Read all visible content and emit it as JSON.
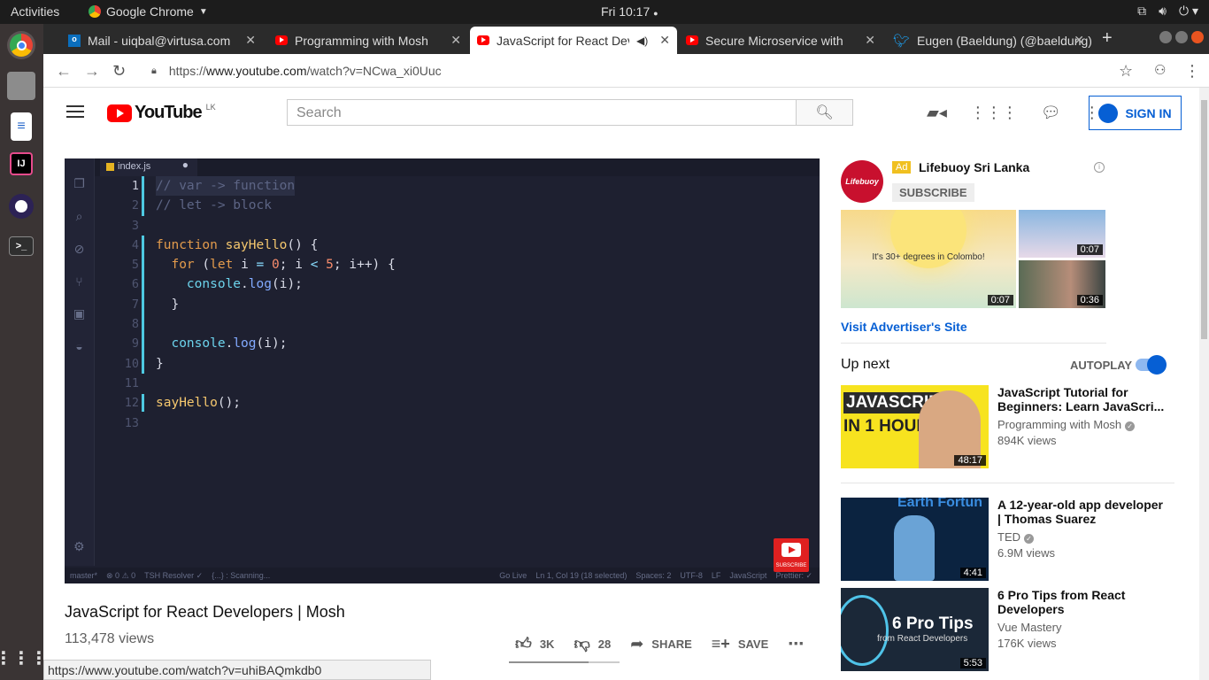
{
  "os": {
    "activities": "Activities",
    "app_name": "Google Chrome",
    "clock": "Fri 10:17"
  },
  "tabs": [
    {
      "title": "Mail - uiqbal@virtusa.com"
    },
    {
      "title": "Programming with Mosh"
    },
    {
      "title": "JavaScript for React Developers"
    },
    {
      "title": "Secure Microservice with"
    },
    {
      "title": "Eugen (Baeldung) (@baeldung)"
    }
  ],
  "address": {
    "prefix": "https://",
    "domain": "www.youtube.com",
    "path": "/watch?v=NCwa_xi0Uuc"
  },
  "yt": {
    "region": "LK",
    "logo_text": "YouTube",
    "search_placeholder": "Search",
    "signin": "SIGN IN"
  },
  "player": {
    "filename": "index.js",
    "code": [
      {
        "n": "1",
        "html": "// var -> function"
      },
      {
        "n": "2",
        "html": "// let -> block"
      },
      {
        "n": "3",
        "html": ""
      },
      {
        "n": "4",
        "html": "function sayHello() {"
      },
      {
        "n": "5",
        "html": "  for (let i = 0; i < 5; i++) {"
      },
      {
        "n": "6",
        "html": "    console.log(i);"
      },
      {
        "n": "7",
        "html": "  }"
      },
      {
        "n": "8",
        "html": ""
      },
      {
        "n": "9",
        "html": "  console.log(i);"
      },
      {
        "n": "10",
        "html": "}"
      },
      {
        "n": "11",
        "html": ""
      },
      {
        "n": "12",
        "html": "sayHello();"
      },
      {
        "n": "13",
        "html": ""
      }
    ],
    "status_left": [
      "master*",
      "⊗ 0 ⚠ 0",
      "TSH Resolver ✓",
      "{...} : Scanning..."
    ],
    "status_right": [
      "Go Live",
      "Ln 1, Col 19 (18 selected)",
      "Spaces: 2",
      "UTF-8",
      "LF",
      "JavaScript",
      "Prettier: ✓"
    ],
    "subscribe_wm": "SUBSCRIBE"
  },
  "video": {
    "title": "JavaScript for React Developers | Mosh",
    "views": "113,478 views",
    "likes": "3K",
    "dislikes": "28",
    "share": "SHARE",
    "save": "SAVE",
    "like_ratio": 0.72
  },
  "ad": {
    "badge": "Ad",
    "name": "Lifebuoy Sri Lanka",
    "subscribe": "SUBSCRIBE",
    "logo_text": "Lifebuoy",
    "main_caption": "It's 30+ degrees in Colombo!",
    "main_duration": "0:07",
    "thumb1_duration": "0:07",
    "thumb2_duration": "0:36",
    "visit": "Visit Advertiser's Site"
  },
  "upnext": {
    "label": "Up next",
    "autoplay": "AUTOPLAY",
    "autoplay_on": true
  },
  "recs": [
    {
      "title": "JavaScript Tutorial for Beginners: Learn JavaScri...",
      "channel": "Programming with Mosh",
      "views": "894K views",
      "duration": "48:17",
      "thumb_line1": "JAVASCRIPT",
      "thumb_line2": "IN 1 HOUR"
    },
    {
      "title": "A 12-year-old app developer | Thomas Suarez",
      "channel": "TED",
      "views": "6.9M views",
      "duration": "4:41",
      "thumb_text": "Earth Fortun"
    },
    {
      "title": "6 Pro Tips from React Developers",
      "channel": "Vue Mastery",
      "views": "176K views",
      "duration": "5:53",
      "thumb_big": "6 Pro Tips",
      "thumb_small": "from React Developers"
    }
  ],
  "status_url": "https://www.youtube.com/watch?v=uhiBAQmkdb0",
  "colors": {
    "yt_red": "#ff0000",
    "link_blue": "#065fd4",
    "editor_bg": "#1e2030"
  }
}
